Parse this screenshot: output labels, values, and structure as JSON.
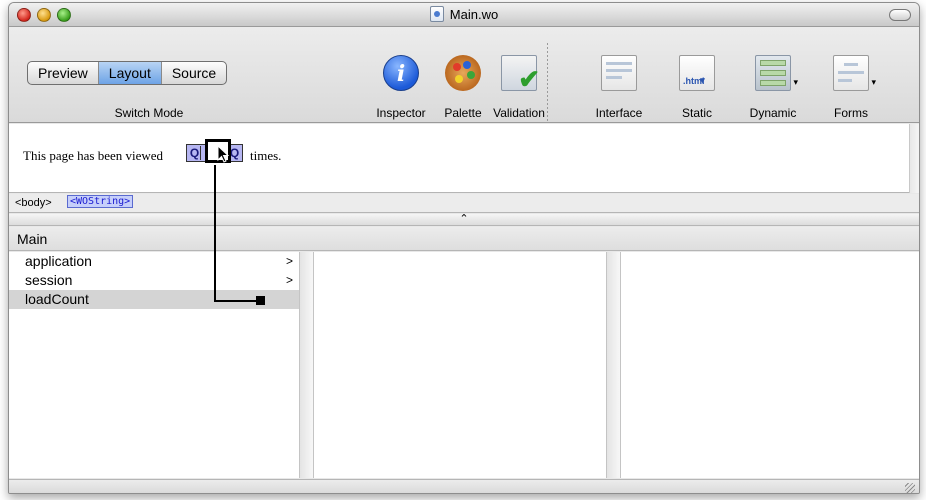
{
  "window": {
    "title": "Main.wo"
  },
  "toolbar": {
    "modes": [
      "Preview",
      "Layout",
      "Source"
    ],
    "active_mode": "Layout",
    "switch_mode_label": "Switch Mode",
    "tools": {
      "inspector": "Inspector",
      "palette": "Palette",
      "validation": "Validation",
      "interface": "Interface",
      "static": "Static",
      "static_icon_text": ".html",
      "dynamic": "Dynamic",
      "forms": "Forms"
    }
  },
  "canvas": {
    "text_before": "This page has been viewed",
    "text_after": "times.",
    "chip_label": "Q"
  },
  "pathbar": {
    "body": "<body>",
    "element": "<WOString>"
  },
  "browser": {
    "header": "Main",
    "items": [
      {
        "label": "application",
        "chevron": ">"
      },
      {
        "label": "session",
        "chevron": ">"
      },
      {
        "label": "loadCount",
        "chevron": ""
      }
    ],
    "selected": "loadCount"
  },
  "icons": {
    "inspector": "info-icon",
    "palette": "palette-icon",
    "validation": "validation-check-icon",
    "interface": "interface-icon",
    "static": "static-html-icon",
    "dynamic": "dynamic-elements-icon",
    "forms": "forms-icon"
  },
  "colors": {
    "active_segment": "#6da3e6",
    "element_fill": "#b6b6f2",
    "selection": "#d4d4d4"
  }
}
